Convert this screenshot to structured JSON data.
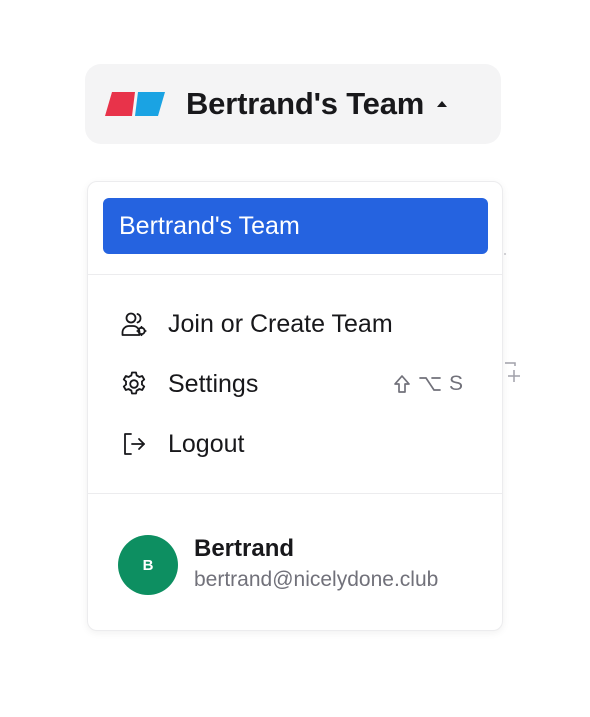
{
  "team_switcher": {
    "team_name": "Bertrand's Team",
    "logo_icon": "brand-logo-icon",
    "caret_icon": "caret-up-icon"
  },
  "dropdown": {
    "teams": [
      {
        "label": "Bertrand's Team",
        "selected": true
      }
    ],
    "menu": [
      {
        "label": "Join or Create Team",
        "icon": "users-icon"
      },
      {
        "label": "Settings",
        "icon": "gear-icon",
        "shortcut_key": "S",
        "shortcut_modifiers": [
          "shift-icon",
          "option-icon"
        ]
      },
      {
        "label": "Logout",
        "icon": "logout-icon"
      }
    ],
    "user": {
      "initial": "B",
      "name": "Bertrand",
      "email": "bertrand@nicelydone.club"
    }
  },
  "colors": {
    "accent": "#2563e0",
    "avatar": "#0d8f61",
    "logo_red": "#e8334a",
    "logo_blue": "#1aa3e3",
    "trigger_bg": "#f4f4f5"
  }
}
